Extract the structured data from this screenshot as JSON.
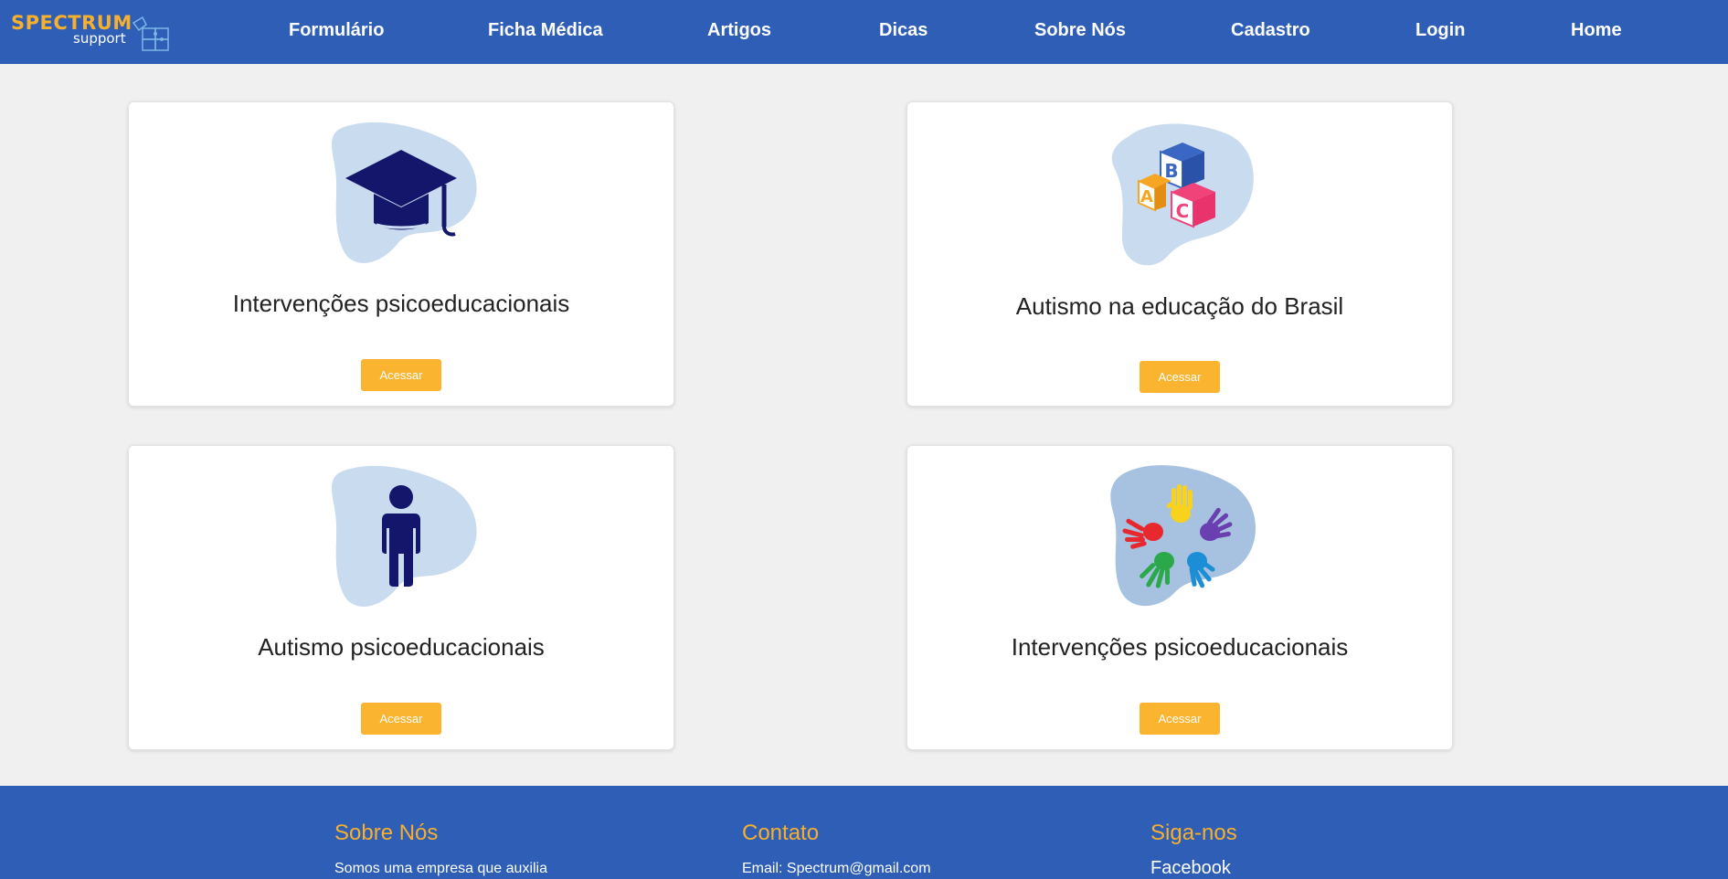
{
  "header": {
    "logo_title": "SPECTRUM",
    "logo_subtitle": "support",
    "nav": [
      "Formulário",
      "Ficha Médica",
      "Artigos",
      "Dicas",
      "Sobre Nós",
      "Cadastro",
      "Login",
      "Home"
    ]
  },
  "cards": [
    {
      "title": "Intervenções psicoeducacionais",
      "button": "Acessar",
      "icon": "graduation-cap-icon"
    },
    {
      "title": "Autismo na educação do Brasil",
      "button": "Acessar",
      "icon": "abc-blocks-icon"
    },
    {
      "title": "Autismo psicoeducacionais",
      "button": "Acessar",
      "icon": "person-icon"
    },
    {
      "title": "Intervenções psicoeducacionais",
      "button": "Acessar",
      "icon": "colorful-hands-icon"
    }
  ],
  "footer": {
    "about_heading": "Sobre Nós",
    "about_text": "Somos uma empresa que auxilia",
    "contact_heading": "Contato",
    "contact_text": "Email: Spectrum@gmail.com",
    "follow_heading": "Siga-nos",
    "follow_link": "Facebook"
  },
  "colors": {
    "primary": "#2e5eb6",
    "accent": "#f7b02d",
    "button": "#fbb430",
    "icon_dark": "#13166b",
    "blob": "#c9dbee"
  }
}
